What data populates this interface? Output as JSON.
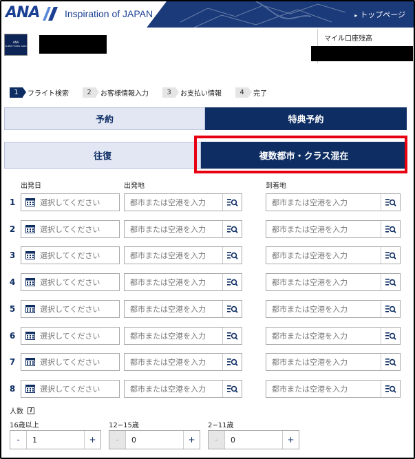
{
  "header": {
    "logo_text": "ANA",
    "tagline": "Inspiration of JAPAN",
    "top_page_link": "トップページ"
  },
  "account": {
    "card_logo_line1": "ANA",
    "card_logo_line2": "SUPER FLYERS CARD",
    "mile_balance_label": "マイル口座残高"
  },
  "steps": [
    {
      "num": "1",
      "label": "フライト検索"
    },
    {
      "num": "2",
      "label": "お客様情報入力"
    },
    {
      "num": "3",
      "label": "お支払い情報"
    },
    {
      "num": "4",
      "label": "完了"
    }
  ],
  "tabs": {
    "booking": "予約",
    "award_booking": "特典予約"
  },
  "trip_type": {
    "round_trip": "往復",
    "multi_city": "複数都市・クラス混在"
  },
  "form": {
    "date_label": "出発日",
    "origin_label": "出発地",
    "destination_label": "到着地",
    "date_placeholder": "選択してください",
    "city_placeholder": "都市または空港を入力",
    "rows": [
      "1",
      "2",
      "3",
      "4",
      "5",
      "6",
      "7",
      "8"
    ]
  },
  "passengers": {
    "label": "人数",
    "adult_label": "16歳以上",
    "child_label": "12−15歳",
    "infant_label": "2−11歳",
    "adult_value": "1",
    "child_value": "0",
    "infant_value": "0",
    "minus": "-",
    "plus": "+"
  },
  "colors": {
    "brand_navy": "#0d2d63",
    "header_blue": "#1a3a7a",
    "highlight_red": "#e60012"
  }
}
